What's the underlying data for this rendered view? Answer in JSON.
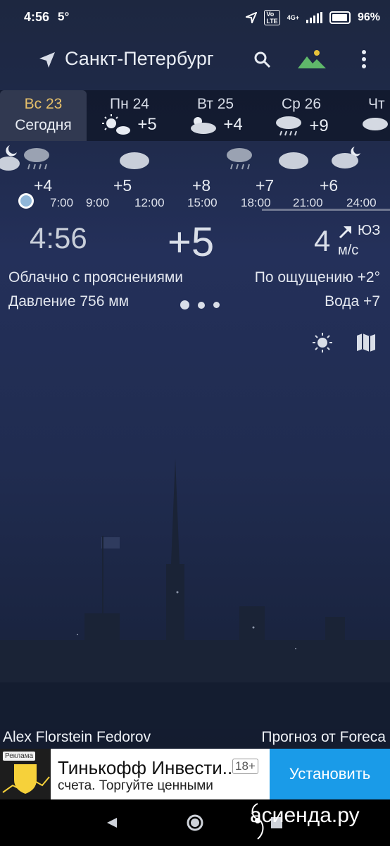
{
  "status_bar": {
    "time": "4:56",
    "temp": "5°",
    "battery": "96%"
  },
  "app_bar": {
    "city": "Санкт-Петербург"
  },
  "days": [
    {
      "name": "Вс 23",
      "sub": "Сегодня",
      "temp": ""
    },
    {
      "name": "Пн 24",
      "sub": "",
      "temp": "+5"
    },
    {
      "name": "Вт 25",
      "sub": "",
      "temp": "+4"
    },
    {
      "name": "Ср 26",
      "sub": "",
      "temp": "+9"
    },
    {
      "name": "Чт",
      "sub": "",
      "temp": ""
    }
  ],
  "hourly": {
    "temps": [
      "+4",
      "+5",
      "+8",
      "+7",
      "+6"
    ],
    "times": [
      "7:00",
      "9:00",
      "12:00",
      "15:00",
      "18:00",
      "21:00",
      "24:00"
    ]
  },
  "current": {
    "time": "4:56",
    "temp": "+5",
    "wind_speed": "4",
    "wind_dir": "ЮЗ",
    "wind_unit": "м/с",
    "condition": "Облачно с прояснениями",
    "feels_like": "По ощущению +2°",
    "pressure": "Давление 756 мм",
    "water": "Вода +7"
  },
  "credits": {
    "photo": "Alex Florstein Fedorov",
    "provider": "Прогноз от Foreca"
  },
  "ad": {
    "tag": "Реклама",
    "title": "Тинькофф Инвести..",
    "age": "18+",
    "subtitle": "счета. Торгуйте ценными",
    "button": "Установить"
  },
  "watermark": "асиенда.ру"
}
